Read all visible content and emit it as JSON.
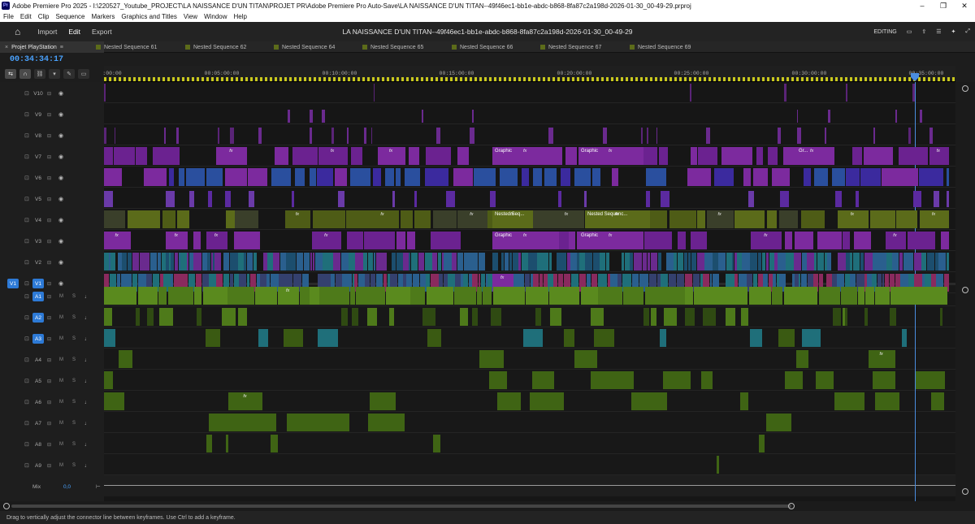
{
  "window": {
    "title": "Adobe Premiere Pro 2025 - I:\\220527_Youtube_PROJECT\\LA NAISSANCE D'UN TITAN\\PROJET PR\\Adobe Premiere Pro Auto-Save\\LA NAISSANCE D'UN TITAN--49f46ec1-bb1e-abdc-b868-8fa87c2a198d-2026-01-30_00-49-29.prproj",
    "app_badge": "Pr"
  },
  "menu": [
    "File",
    "Edit",
    "Clip",
    "Sequence",
    "Markers",
    "Graphics and Titles",
    "View",
    "Window",
    "Help"
  ],
  "workspace": {
    "tabs": [
      "Import",
      "Edit",
      "Export"
    ],
    "active": "Edit",
    "doc_title": "LA NAISSANCE D'UN TITAN--49f46ec1-bb1e-abdc-b868-8fa87c2a198d-2026-01-30_00-49-29",
    "mode": "EDITING"
  },
  "project_tab": "Projet PlayStation",
  "sequence_tabs": [
    "Nested Sequence 61",
    "Nested Sequence 62",
    "Nested Sequence 64",
    "Nested Sequence 65",
    "Nested Sequence 66",
    "Nested Sequence 67",
    "Nested Sequence 69"
  ],
  "timecode": "00:34:34:17",
  "ruler": {
    "labels": [
      ":00:00",
      "00:05:00:00",
      "00:10:00:00",
      "00:15:00:00",
      "00:20:00:00",
      "00:25:00:00",
      "00:30:00:00",
      "00:35:00:00"
    ]
  },
  "video_tracks": [
    "V10",
    "V9",
    "V8",
    "V7",
    "V6",
    "V5",
    "V4",
    "V3",
    "V2",
    "V1"
  ],
  "audio_tracks": [
    "A1",
    "A2",
    "A3",
    "A4",
    "A5",
    "A6",
    "A7",
    "A8",
    "A9"
  ],
  "source_patch": {
    "video": "V1"
  },
  "track_buttons": {
    "mute": "M",
    "solo": "S"
  },
  "mix": {
    "label": "Mix",
    "value": "0,0"
  },
  "clip_labels": {
    "graphic": "Graphic",
    "graphic_short": "Gr...",
    "nested_seq": "Nested Seq...",
    "nested_sequence": "Nested Sequenc...",
    "fx": "fx"
  },
  "status": "Drag to vertically adjust the connector line between keyframes. Use Ctrl to add a keyframe.",
  "colors": {
    "purple": "#7c2a9e",
    "blue": "#2a6c9e",
    "olive": "#5b6b1a",
    "audio_green": "#4e7a1a",
    "teal": "#1f6f7a",
    "accent": "#4a8de0"
  }
}
